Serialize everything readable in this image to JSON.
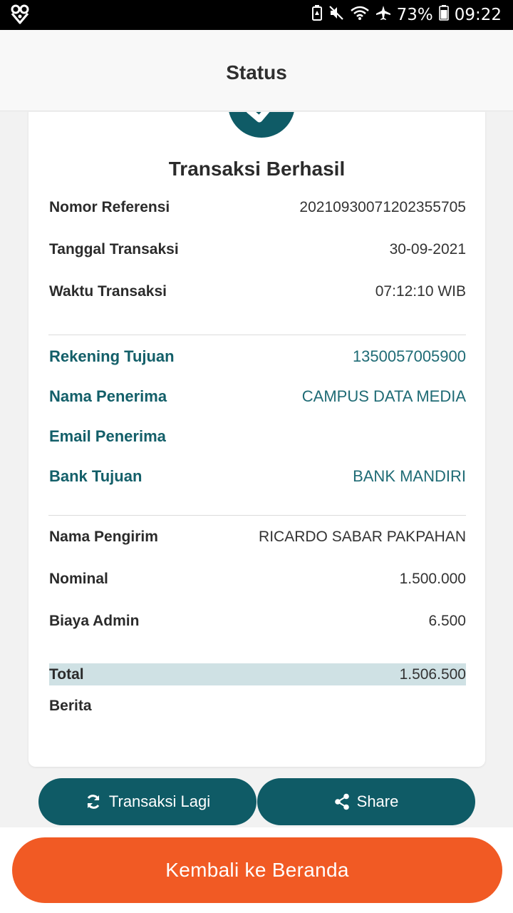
{
  "status_bar": {
    "battery_percent": "73%",
    "time": "09:22",
    "icons": [
      "app-logo-icon",
      "battery-saver-icon",
      "mute-icon",
      "wifi-icon",
      "airplane-icon",
      "battery-icon"
    ]
  },
  "header": {
    "title": "Status"
  },
  "card": {
    "title": "Transaksi Berhasil",
    "details": [
      {
        "label": "Nomor Referensi",
        "value": "20210930071202355705"
      },
      {
        "label": "Tanggal Transaksi",
        "value": "30-09-2021"
      },
      {
        "label": "Waktu Transaksi",
        "value": "07:12:10 WIB"
      }
    ],
    "recipient": [
      {
        "label": "Rekening Tujuan",
        "value": "1350057005900"
      },
      {
        "label": "Nama Penerima",
        "value": "CAMPUS DATA MEDIA"
      },
      {
        "label": "Email Penerima",
        "value": ""
      },
      {
        "label": "Bank Tujuan",
        "value": "BANK MANDIRI"
      }
    ],
    "sender": [
      {
        "label": "Nama Pengirim",
        "value": "RICARDO SABAR PAKPAHAN"
      },
      {
        "label": "Nominal",
        "value": "1.500.000"
      },
      {
        "label": "Biaya Admin",
        "value": "6.500"
      },
      {
        "label": "Total",
        "value": "1.506.500"
      },
      {
        "label": "Berita",
        "value": ""
      }
    ]
  },
  "actions": {
    "repeat_label": "Transaksi Lagi",
    "share_label": "Share"
  },
  "footer": {
    "home_label": "Kembali ke Beranda"
  },
  "colors": {
    "primary": "#0f5b66",
    "accent": "#f15a24",
    "total_highlight": "#cfe1e4"
  }
}
